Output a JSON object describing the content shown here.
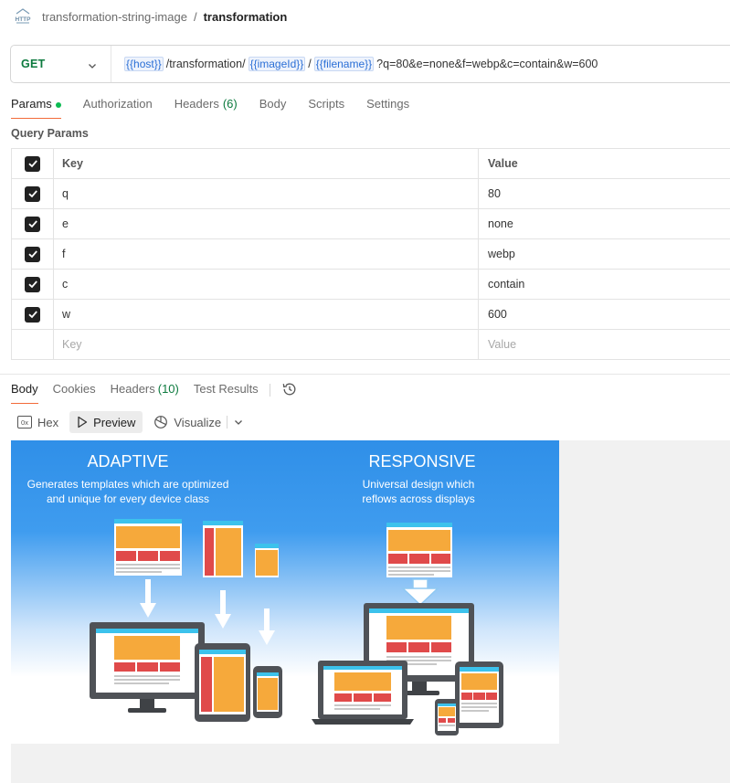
{
  "breadcrumb": {
    "icon": "http-icon",
    "icon_text": "HTTP",
    "parent": "transformation-string-image",
    "separator": "/",
    "current": "transformation"
  },
  "request": {
    "method": "GET",
    "url_parts": {
      "host": "{{host}}",
      "path1": "/transformation/",
      "image_id": "{{imageId}}",
      "slash": "/",
      "filename": "{{filename}}",
      "query": "?q=80&e=none&f=webp&c=contain&w=600"
    }
  },
  "request_tabs": [
    {
      "label": "Params",
      "active": true,
      "has_dot": true
    },
    {
      "label": "Authorization"
    },
    {
      "label": "Headers",
      "count": "(6)"
    },
    {
      "label": "Body"
    },
    {
      "label": "Scripts"
    },
    {
      "label": "Settings"
    }
  ],
  "query_params": {
    "title": "Query Params",
    "header_key": "Key",
    "header_value": "Value",
    "rows": [
      {
        "key": "q",
        "value": "80",
        "checked": true
      },
      {
        "key": "e",
        "value": "none",
        "checked": true
      },
      {
        "key": "f",
        "value": "webp",
        "checked": true
      },
      {
        "key": "c",
        "value": "contain",
        "checked": true
      },
      {
        "key": "w",
        "value": "600",
        "checked": true
      }
    ],
    "placeholder_key": "Key",
    "placeholder_value": "Value"
  },
  "response_tabs": [
    {
      "label": "Body",
      "active": true
    },
    {
      "label": "Cookies"
    },
    {
      "label": "Headers",
      "count": "(10)"
    },
    {
      "label": "Test Results"
    }
  ],
  "body_toolbar": {
    "hex": "Hex",
    "preview": "Preview",
    "visualize": "Visualize"
  },
  "preview_image": {
    "left_title": "ADAPTIVE",
    "left_sub1": "Generates templates which are optimized",
    "left_sub2": "and unique for every device class",
    "right_title": "RESPONSIVE",
    "right_sub1": "Universal design which",
    "right_sub2": "reflows across displays",
    "colors": {
      "sky_top": "#2f8fe8",
      "sky_bottom": "#ffffff",
      "orange": "#f6a93b",
      "red": "#e04a4a",
      "cyan": "#3cc2ec",
      "device": "#4f5257"
    }
  }
}
